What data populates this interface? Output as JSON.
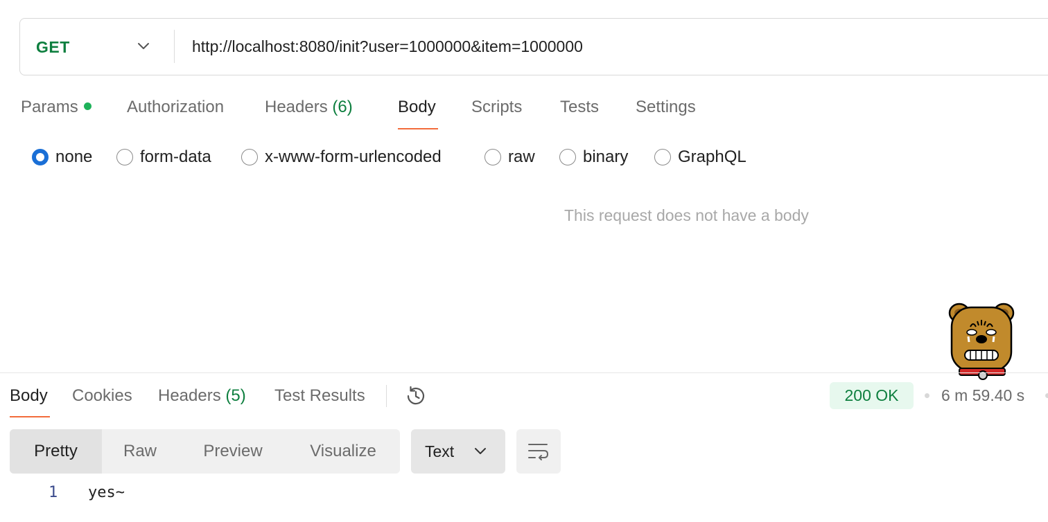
{
  "request": {
    "method": "GET",
    "url": "http://localhost:8080/init?user=1000000&item=1000000"
  },
  "request_tabs": {
    "params": "Params",
    "authorization": "Authorization",
    "headers": "Headers",
    "headers_count": "(6)",
    "body": "Body",
    "scripts": "Scripts",
    "tests": "Tests",
    "settings": "Settings",
    "active": "Body"
  },
  "body_options": {
    "none": "none",
    "form_data": "form-data",
    "urlencoded": "x-www-form-urlencoded",
    "raw": "raw",
    "binary": "binary",
    "graphql": "GraphQL",
    "selected": "none"
  },
  "body_empty_message": "This request does not have a body",
  "response_tabs": {
    "body": "Body",
    "cookies": "Cookies",
    "headers": "Headers",
    "headers_count": "(5)",
    "test_results": "Test Results",
    "active": "Body"
  },
  "response_meta": {
    "status": "200 OK",
    "time": "6 m 59.40 s"
  },
  "format_tabs": {
    "pretty": "Pretty",
    "raw": "Raw",
    "preview": "Preview",
    "visualize": "Visualize",
    "active": "Pretty"
  },
  "response_type": "Text",
  "response_body": {
    "line_number": "1",
    "content": "yes~"
  },
  "colors": {
    "method_green": "#0e7f3f",
    "accent_orange": "#f26b3a",
    "radio_blue": "#1a6fd6",
    "status_bg": "#e7f8ee"
  },
  "icons": [
    "chevron-down-icon",
    "history-icon",
    "wrap-lines-icon",
    "mascot-sticker"
  ]
}
